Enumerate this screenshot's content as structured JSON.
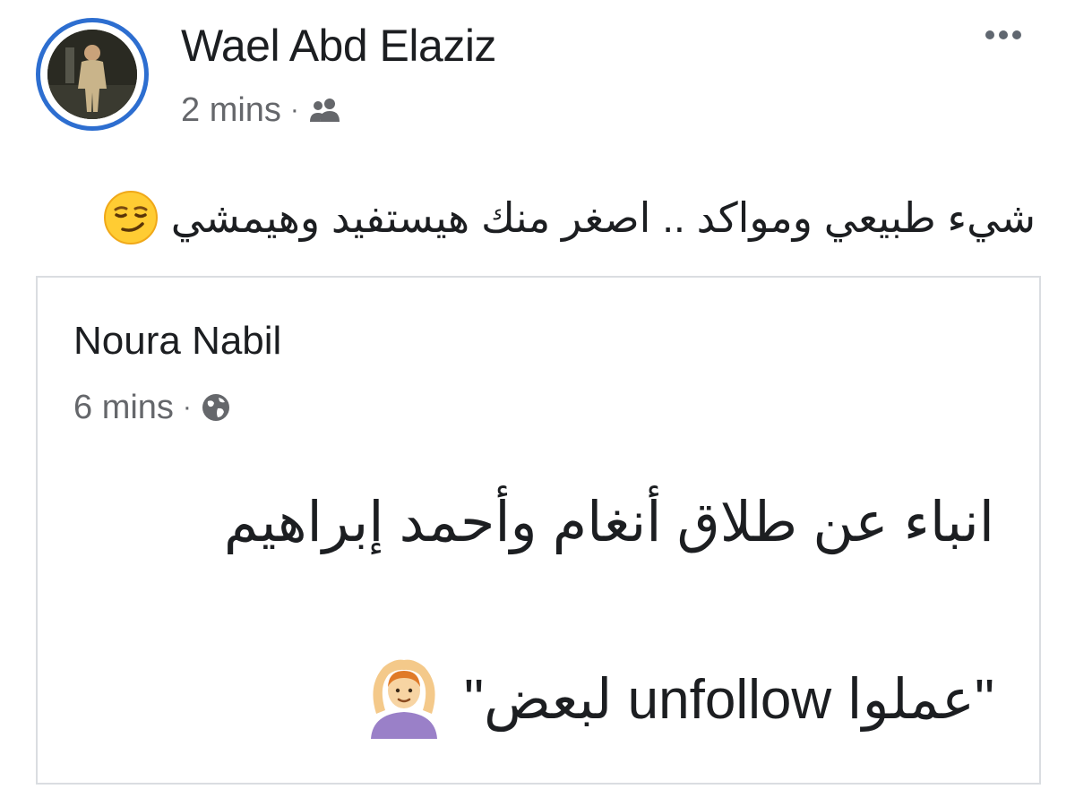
{
  "post": {
    "author_name": "Wael Abd Elaziz",
    "time": "2 mins",
    "separator": "·",
    "audience_icon": "friends-icon",
    "more_icon": "more-options-icon",
    "text": "شيء طبيعي ومواكد .. اصغر منك هيستفيد وهيمشي",
    "text_emoji": "smirking-face-icon"
  },
  "shared_post": {
    "author_name": "Noura Nabil",
    "time": "6 mins",
    "separator": "·",
    "audience_icon": "globe-icon",
    "line1": "انباء عن طلاق أنغام وأحمد إبراهيم",
    "line2": "\"عملوا unfollow لبعض\"",
    "line2_emoji": "person-gesturing-ok-icon"
  },
  "colors": {
    "avatar_ring": "#2d6ed0",
    "meta_text": "#65676b",
    "card_border": "#dadde1"
  }
}
